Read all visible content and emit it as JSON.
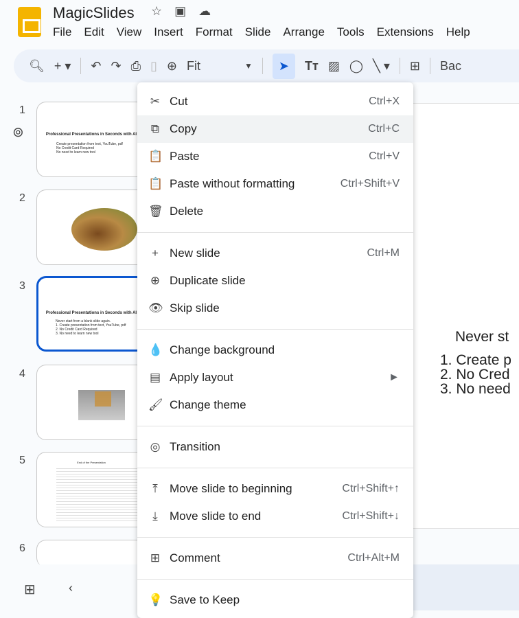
{
  "app": {
    "title": "MagicSlides"
  },
  "menubar": [
    "File",
    "Edit",
    "View",
    "Insert",
    "Format",
    "Slide",
    "Arrange",
    "Tools",
    "Extensions",
    "Help"
  ],
  "toolbar": {
    "zoom": "Fit",
    "background": "Bac"
  },
  "slides": [
    {
      "num": "1",
      "title": "Professional Presentations in Seconds with AI",
      "bullets": [
        "Create presentation from text, YouTube, pdf",
        "No Credit Card Required",
        "No need to learn new tool"
      ]
    },
    {
      "num": "2"
    },
    {
      "num": "3",
      "title": "Professional Presentations in Seconds with AI",
      "subtitle": "Never start from a blank slide again.",
      "bullets": [
        "1. Create presentation from text, YouTube, pdf",
        "2. No Credit Card Required",
        "3. No need to learn new tool"
      ]
    },
    {
      "num": "4"
    },
    {
      "num": "5",
      "title": "End of the Presentation"
    },
    {
      "num": "6"
    }
  ],
  "canvas": {
    "heading": "Never st",
    "items": [
      "1. Create p",
      "2. No Cred",
      "3. No need"
    ]
  },
  "context_menu": [
    {
      "label": "Cut",
      "shortcut": "Ctrl+X",
      "icon": "✂"
    },
    {
      "label": "Copy",
      "shortcut": "Ctrl+C",
      "icon": "⧉"
    },
    {
      "label": "Paste",
      "shortcut": "Ctrl+V",
      "icon": "📋"
    },
    {
      "label": "Paste without formatting",
      "shortcut": "Ctrl+Shift+V",
      "icon": "📋"
    },
    {
      "label": "Delete",
      "shortcut": "",
      "icon": "🗑"
    },
    {
      "label": "New slide",
      "shortcut": "Ctrl+M",
      "icon": "+"
    },
    {
      "label": "Duplicate slide",
      "shortcut": "",
      "icon": "⊕"
    },
    {
      "label": "Skip slide",
      "shortcut": "",
      "icon": "👁"
    },
    {
      "label": "Change background",
      "shortcut": "",
      "icon": "💧"
    },
    {
      "label": "Apply layout",
      "shortcut": "►",
      "icon": "▤"
    },
    {
      "label": "Change theme",
      "shortcut": "",
      "icon": "🖌"
    },
    {
      "label": "Transition",
      "shortcut": "",
      "icon": "◎"
    },
    {
      "label": "Move slide to beginning",
      "shortcut": "Ctrl+Shift+↑",
      "icon": "⤒"
    },
    {
      "label": "Move slide to end",
      "shortcut": "Ctrl+Shift+↓",
      "icon": "⤓"
    },
    {
      "label": "Comment",
      "shortcut": "Ctrl+Alt+M",
      "icon": "⊞"
    },
    {
      "label": "Save to Keep",
      "shortcut": "",
      "icon": "💡"
    }
  ]
}
